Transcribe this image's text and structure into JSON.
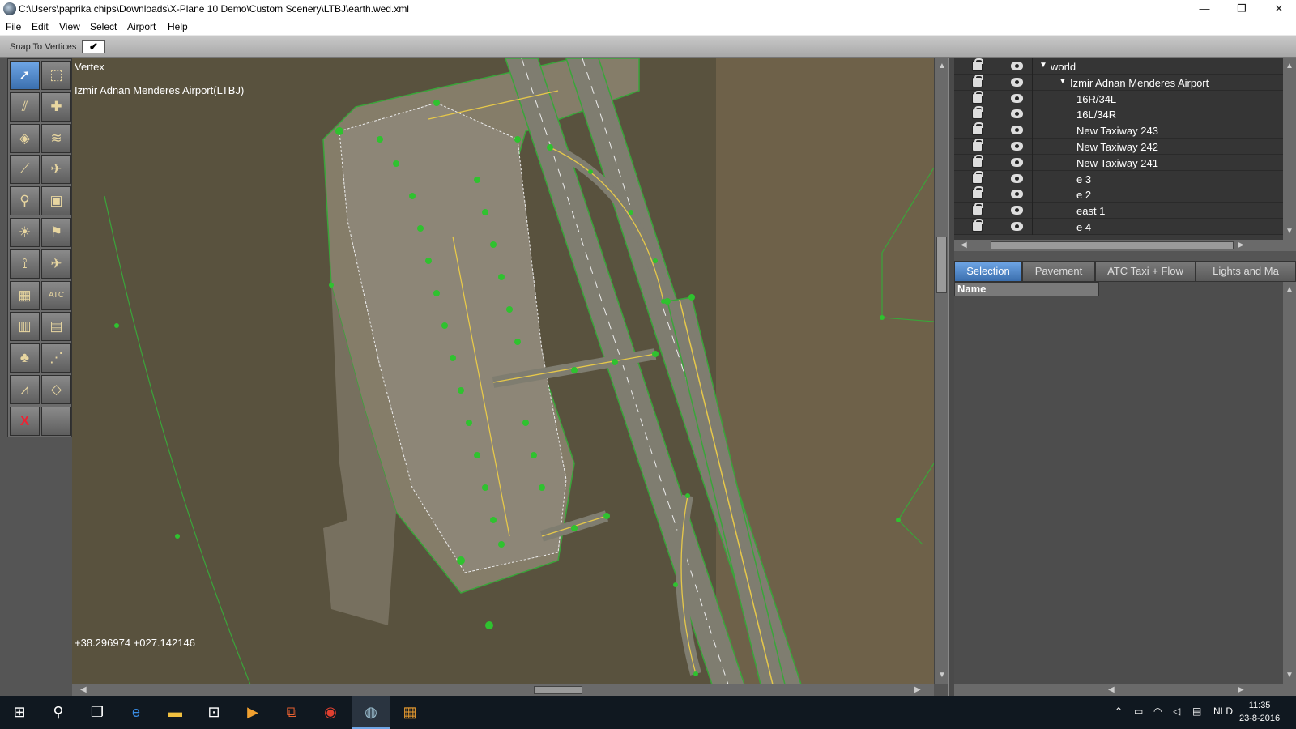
{
  "window": {
    "title": "C:\\Users\\paprika chips\\Downloads\\X-Plane 10 Demo\\Custom Scenery\\LTBJ\\earth.wed.xml",
    "controls": {
      "minimize": "—",
      "restore": "❐",
      "close": "✕"
    }
  },
  "menu": {
    "items": [
      "File",
      "Edit",
      "View",
      "Select",
      "Airport",
      "Help"
    ]
  },
  "toolbar": {
    "snap_label": "Snap To Vertices",
    "snap_checked": "✔"
  },
  "tools": [
    {
      "name": "vertex-tool",
      "icon": "➚",
      "selected": true
    },
    {
      "name": "marquee-tool",
      "icon": "⬚"
    },
    {
      "name": "runway-tool",
      "icon": "⫽"
    },
    {
      "name": "helipad-tool",
      "icon": "✚"
    },
    {
      "name": "taxiway-tool",
      "icon": "◈"
    },
    {
      "name": "taxiline-tool",
      "icon": "≋"
    },
    {
      "name": "boundary-tool",
      "icon": "⟋"
    },
    {
      "name": "ramp-start-tool",
      "icon": "✈"
    },
    {
      "name": "tower-viewpoint-tool",
      "icon": "⚲"
    },
    {
      "name": "sign-tool",
      "icon": "▣"
    },
    {
      "name": "beacon-tool",
      "icon": "☀"
    },
    {
      "name": "windsock-tool",
      "icon": "⚑"
    },
    {
      "name": "light-fixture-tool",
      "icon": "⟟"
    },
    {
      "name": "airplane-tool",
      "icon": "✈"
    },
    {
      "name": "object-tool",
      "icon": "▦"
    },
    {
      "name": "atc-tool",
      "icon": "ATC"
    },
    {
      "name": "facade-tool",
      "icon": "▥"
    },
    {
      "name": "forest-tool",
      "icon": "▤"
    },
    {
      "name": "tree-tool",
      "icon": "♣"
    },
    {
      "name": "line-tool",
      "icon": "⋰"
    },
    {
      "name": "string-tool",
      "icon": "⩘"
    },
    {
      "name": "polygon-tool",
      "icon": "◇"
    },
    {
      "name": "delete-tool",
      "icon": "X"
    },
    {
      "name": "empty-tool",
      "icon": ""
    }
  ],
  "map": {
    "mode_label": "Vertex",
    "airport_label": "Izmir Adnan Menderes Airport(LTBJ)",
    "coordinates": "+38.296974 +027.142146"
  },
  "tree": {
    "rows": [
      {
        "label": "world",
        "indent": 0,
        "expanded": "▼"
      },
      {
        "label": "Izmir Adnan Menderes Airport",
        "indent": 1,
        "expanded": "▼"
      },
      {
        "label": "16R/34L",
        "indent": 2
      },
      {
        "label": "16L/34R",
        "indent": 2
      },
      {
        "label": "New Taxiway 243",
        "indent": 2
      },
      {
        "label": "New Taxiway 242",
        "indent": 2
      },
      {
        "label": "New Taxiway 241",
        "indent": 2
      },
      {
        "label": "e 3",
        "indent": 2
      },
      {
        "label": "e 2",
        "indent": 2
      },
      {
        "label": "east 1",
        "indent": 2
      },
      {
        "label": "e 4",
        "indent": 2
      }
    ]
  },
  "tabs": [
    "Selection",
    "Pavement",
    "ATC Taxi + Flow",
    "Lights and Ma"
  ],
  "properties": {
    "column_header": "Name"
  },
  "taskbar": {
    "language": "NLD",
    "time": "11:35",
    "date": "23-8-2016"
  },
  "colors": {
    "accent": "#3b6fae",
    "map_background": "#59523e",
    "vertex_green": "#2fc22f"
  }
}
